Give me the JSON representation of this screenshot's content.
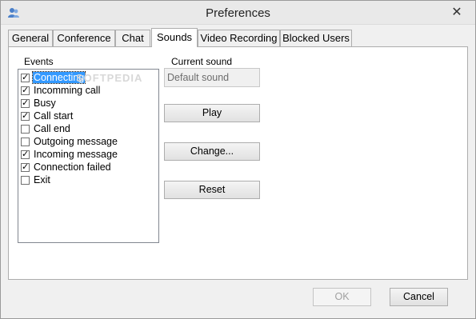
{
  "window": {
    "title": "Preferences",
    "close_glyph": "✕",
    "app_icon": "users-icon"
  },
  "tabs": [
    {
      "label": "General"
    },
    {
      "label": "Conference"
    },
    {
      "label": "Chat"
    },
    {
      "label": "Sounds",
      "active": true
    },
    {
      "label": "Video Recording"
    },
    {
      "label": "Blocked Users"
    }
  ],
  "sounds": {
    "events_label": "Events",
    "events": [
      {
        "label": "Connecting",
        "checked": true,
        "selected": true
      },
      {
        "label": "Incomming call",
        "checked": true
      },
      {
        "label": "Busy",
        "checked": true
      },
      {
        "label": "Call start",
        "checked": true
      },
      {
        "label": "Call end",
        "checked": false
      },
      {
        "label": "Outgoing message",
        "checked": false
      },
      {
        "label": "Incoming message",
        "checked": true
      },
      {
        "label": "Connection failed",
        "checked": true
      },
      {
        "label": "Exit",
        "checked": false
      }
    ],
    "current_sound_label": "Current sound",
    "current_sound_value": "Default sound",
    "play_label": "Play",
    "change_label": "Change...",
    "reset_label": "Reset",
    "watermark": "SOFTPEDIA"
  },
  "footer": {
    "ok_label": "OK",
    "ok_enabled": false,
    "cancel_label": "Cancel"
  }
}
